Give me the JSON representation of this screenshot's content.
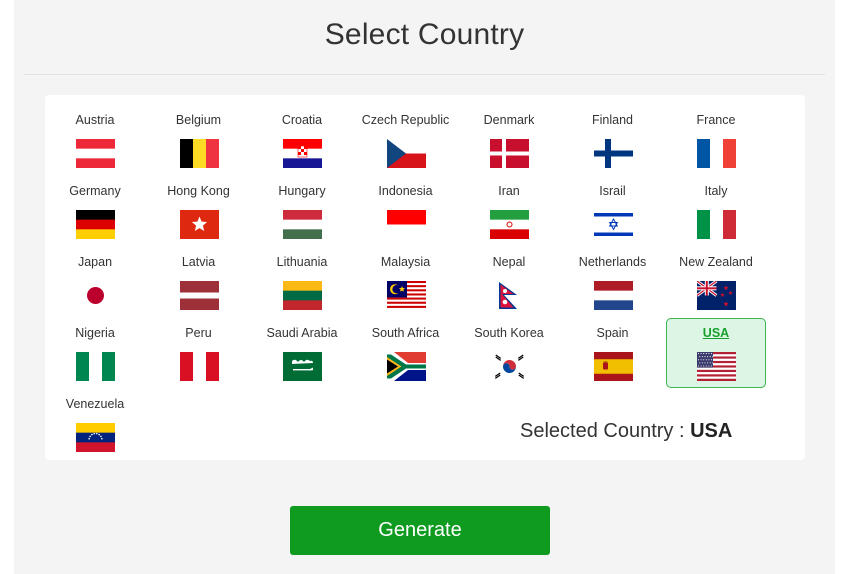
{
  "page": {
    "title": "Select Country"
  },
  "countries": [
    {
      "name": "Austria",
      "flag_icon": "austria-flag"
    },
    {
      "name": "Belgium",
      "flag_icon": "belgium-flag"
    },
    {
      "name": "Croatia",
      "flag_icon": "croatia-flag"
    },
    {
      "name": "Czech Republic",
      "flag_icon": "czech-republic-flag"
    },
    {
      "name": "Denmark",
      "flag_icon": "denmark-flag"
    },
    {
      "name": "Finland",
      "flag_icon": "finland-flag"
    },
    {
      "name": "France",
      "flag_icon": "france-flag"
    },
    {
      "name": "Germany",
      "flag_icon": "germany-flag"
    },
    {
      "name": "Hong Kong",
      "flag_icon": "hong-kong-flag"
    },
    {
      "name": "Hungary",
      "flag_icon": "hungary-flag"
    },
    {
      "name": "Indonesia",
      "flag_icon": "indonesia-flag"
    },
    {
      "name": "Iran",
      "flag_icon": "iran-flag"
    },
    {
      "name": "Israil",
      "flag_icon": "israel-flag"
    },
    {
      "name": "Italy",
      "flag_icon": "italy-flag"
    },
    {
      "name": "Japan",
      "flag_icon": "japan-flag"
    },
    {
      "name": "Latvia",
      "flag_icon": "latvia-flag"
    },
    {
      "name": "Lithuania",
      "flag_icon": "lithuania-flag"
    },
    {
      "name": "Malaysia",
      "flag_icon": "malaysia-flag"
    },
    {
      "name": "Nepal",
      "flag_icon": "nepal-flag"
    },
    {
      "name": "Netherlands",
      "flag_icon": "netherlands-flag"
    },
    {
      "name": "New Zealand",
      "flag_icon": "new-zealand-flag"
    },
    {
      "name": "Nigeria",
      "flag_icon": "nigeria-flag"
    },
    {
      "name": "Peru",
      "flag_icon": "peru-flag"
    },
    {
      "name": "Saudi Arabia",
      "flag_icon": "saudi-arabia-flag"
    },
    {
      "name": "South Africa",
      "flag_icon": "south-africa-flag"
    },
    {
      "name": "South Korea",
      "flag_icon": "south-korea-flag"
    },
    {
      "name": "Spain",
      "flag_icon": "spain-flag"
    },
    {
      "name": "USA",
      "flag_icon": "usa-flag",
      "selected": true
    },
    {
      "name": "Venezuela",
      "flag_icon": "venezuela-flag"
    }
  ],
  "selection": {
    "label": "Selected Country :",
    "value": "USA"
  },
  "actions": {
    "generate_label": "Generate"
  },
  "colors": {
    "accent": "#0f9a20",
    "selected_bg": "#dcf5e4",
    "selected_border": "#3db550"
  }
}
